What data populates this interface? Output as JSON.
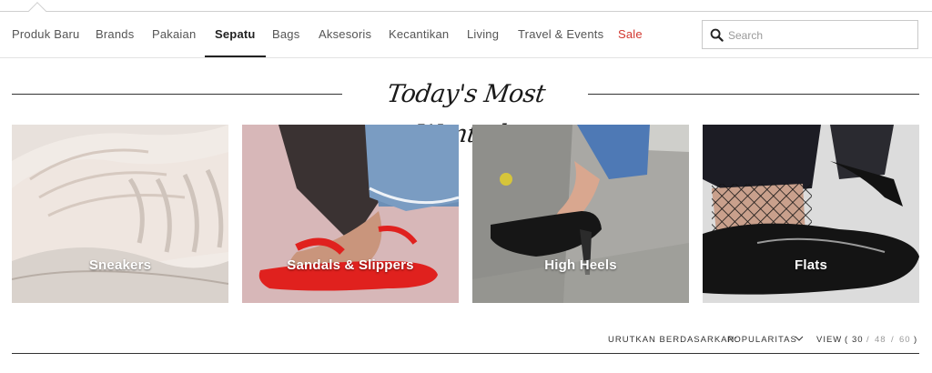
{
  "nav": {
    "items": [
      {
        "label": "Produk Baru"
      },
      {
        "label": "Brands"
      },
      {
        "label": "Pakaian"
      },
      {
        "label": "Sepatu"
      },
      {
        "label": "Bags"
      },
      {
        "label": "Aksesoris"
      },
      {
        "label": "Kecantikan"
      },
      {
        "label": "Living"
      },
      {
        "label": "Travel & Events"
      },
      {
        "label": "Sale"
      }
    ],
    "active": "Sepatu",
    "sale_color": "#d2372f"
  },
  "search": {
    "placeholder": "Search",
    "icon": "search-icon"
  },
  "section": {
    "title": "Today's Most Wanted"
  },
  "categories": [
    {
      "label": "Sneakers"
    },
    {
      "label": "Sandals & Slippers"
    },
    {
      "label": "High Heels"
    },
    {
      "label": "Flats"
    }
  ],
  "sort": {
    "label": "URUTKAN BERDASARKAN:",
    "value": "POPULARITAS",
    "icon": "chevron-down-icon"
  },
  "view": {
    "label": "VIEW",
    "open": "(",
    "close": ")",
    "separator": "/",
    "options": [
      "30",
      "48",
      "60"
    ],
    "selected": "30"
  }
}
